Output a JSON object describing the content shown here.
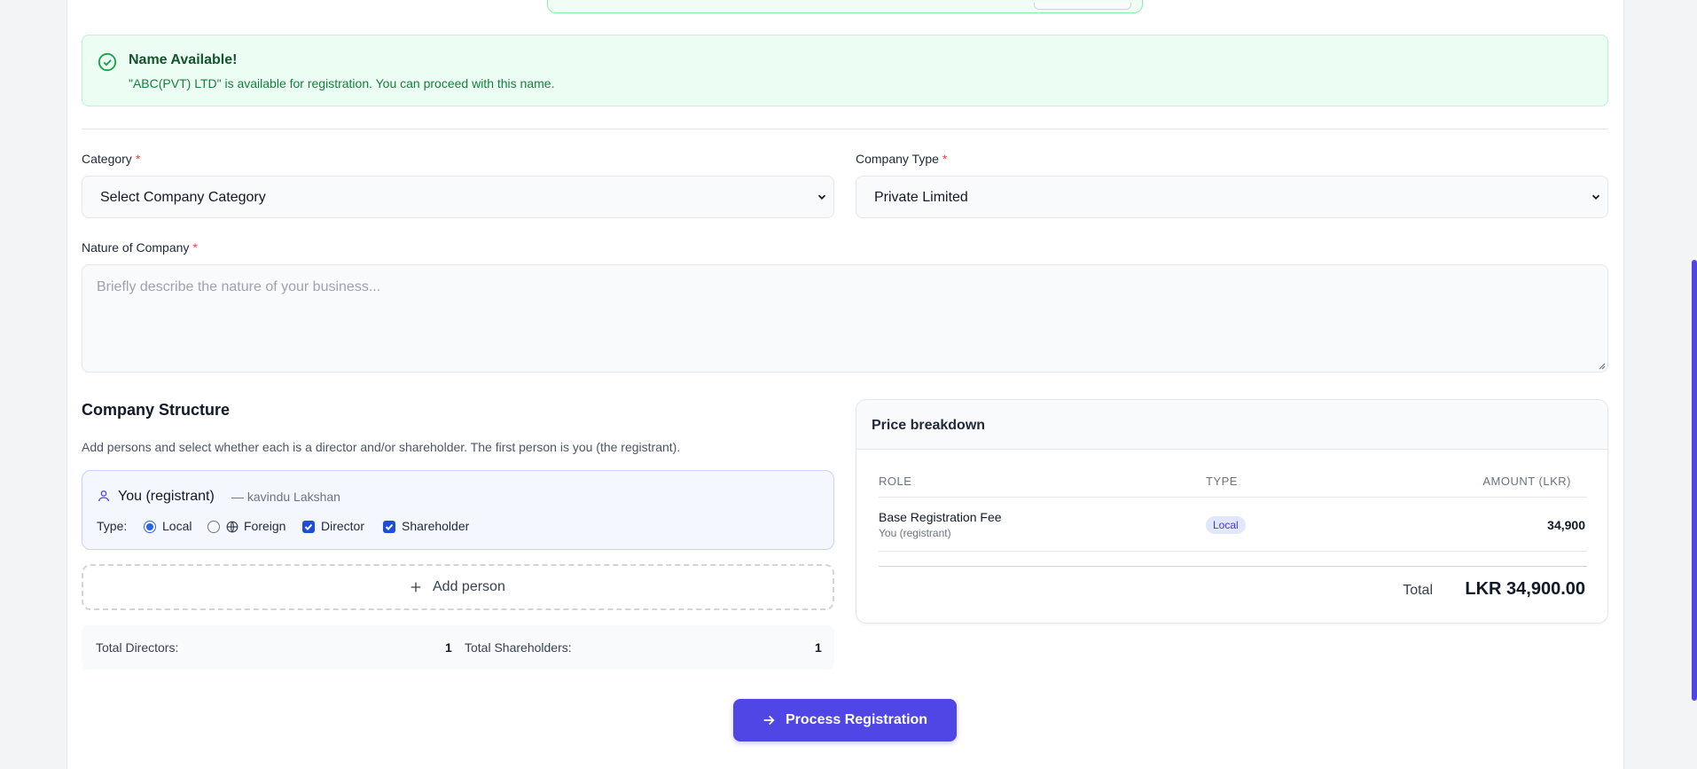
{
  "alert": {
    "title": "Name Available!",
    "message": "\"ABC(PVT) LTD\" is available for registration. You can proceed with this name.",
    "icon": "check-circle-icon",
    "color": "#16a34a"
  },
  "form": {
    "category": {
      "label": "Category",
      "required": "*",
      "value": "Select Company Category"
    },
    "company_type": {
      "label": "Company Type",
      "required": "*",
      "value": "Private Limited"
    },
    "nature": {
      "label": "Nature of Company",
      "required": "*",
      "placeholder": "Briefly describe the nature of your business..."
    }
  },
  "structure": {
    "title": "Company Structure",
    "description": "Add persons and select whether each is a director and/or shareholder. The first person is you (the registrant).",
    "person": {
      "name": "You (registrant)",
      "subtitle": "— kavindu Lakshan",
      "type_label": "Type:",
      "local_label": "Local",
      "foreign_label": "Foreign",
      "director_label": "Director",
      "shareholder_label": "Shareholder",
      "selected_type": "Local",
      "director_checked": true,
      "shareholder_checked": true
    },
    "add_person_label": "Add person",
    "totals": {
      "directors_label": "Total Directors:",
      "directors_value": "1",
      "shareholders_label": "Total Shareholders:",
      "shareholders_value": "1"
    }
  },
  "price": {
    "title": "Price breakdown",
    "columns": [
      "ROLE",
      "TYPE",
      "AMOUNT (LKR)"
    ],
    "rows": [
      {
        "role": "Base Registration Fee",
        "sub": "You (registrant)",
        "type": "Local",
        "amount": "34,900"
      }
    ],
    "total_label": "Total",
    "total_value": "LKR 34,900.00"
  },
  "cta": {
    "label": "Process Registration",
    "color": "#4f46e5"
  }
}
